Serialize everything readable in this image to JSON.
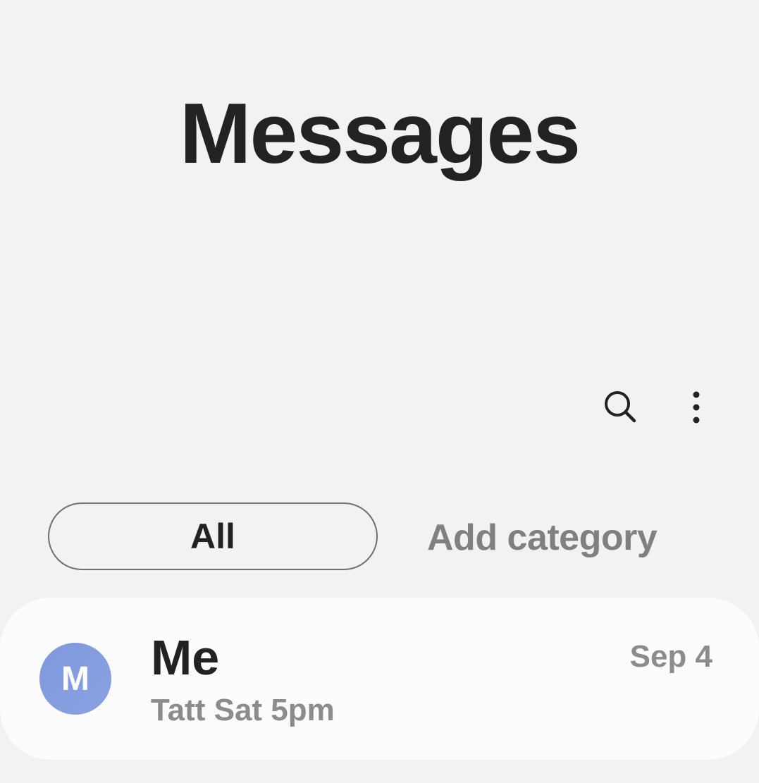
{
  "header": {
    "title": "Messages"
  },
  "toolbar": {
    "search_icon": "search-icon",
    "more_icon": "more-vertical-icon"
  },
  "filters": {
    "active": "All",
    "add_label": "Add category"
  },
  "conversations": [
    {
      "avatar_letter": "M",
      "name": "Me",
      "snippet": "Tatt Sat 5pm",
      "date": "Sep 4"
    }
  ],
  "colors": {
    "background": "#f2f2f2",
    "card": "#fcfcfc",
    "avatar": "#879ee0",
    "text_primary": "#222222",
    "text_secondary": "#8c8c8c"
  }
}
